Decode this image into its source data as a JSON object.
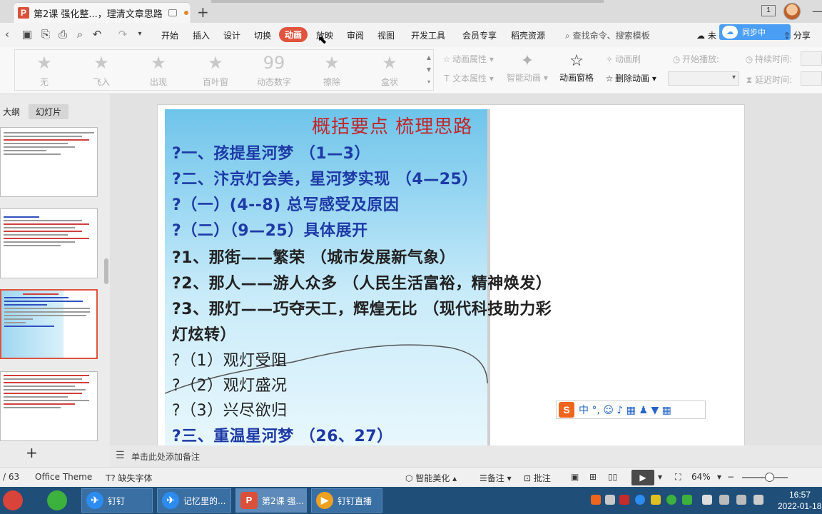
{
  "window": {
    "tab_title": "第2课 强化整...，理清文章思路",
    "logo_letter": "P",
    "new_tab": "+",
    "badge": "1"
  },
  "menu": {
    "items": [
      "开始",
      "插入",
      "设计",
      "切换",
      "动画",
      "放映",
      "审阅",
      "视图",
      "开发工具",
      "会员专享",
      "稻壳资源"
    ],
    "active": "动画",
    "search_placeholder": "查找命令、搜索模板",
    "cloud_status": "未",
    "cloud_badge_text": "同步中",
    "share": "分享"
  },
  "ribbon": {
    "effects": [
      "无",
      "飞入",
      "出现",
      "百叶窗",
      "动态数字",
      "擦除",
      "盒状"
    ],
    "animation_props": "动画属性",
    "text_props": "文本属性",
    "smart_animation": "智能动画",
    "animation_pane": "动画窗格",
    "animation_brush": "动画刷",
    "delete_animation": "删除动画",
    "start_play": "开始播放:",
    "duration": "持续时间:",
    "delay": "延迟时间:"
  },
  "left_panel": {
    "tab_outline": "大纲",
    "tab_slides": "幻灯片",
    "add_slide": "+"
  },
  "slide": {
    "title": "概括要点  梳理思路",
    "lines": [
      {
        "text": "?一、孩提星河梦       （1—3）",
        "style": "blue"
      },
      {
        "text": "?二、汴京灯会美，星河梦实现   （4—25）",
        "style": "blue"
      },
      {
        "text": "?（一）(4--8) 总写感受及原因",
        "style": "blue"
      },
      {
        "text": "?（二）（9—25）具体展开",
        "style": "blue"
      },
      {
        "text": "?1、那街——繁荣    （城市发展新气象）",
        "style": "dark"
      },
      {
        "text": "?2、那人——游人众多   （人民生活富裕，精神焕发）",
        "style": "dark"
      },
      {
        "text": "?3、那灯——巧夺天工，辉煌无比  （现代科技助力彩",
        "style": "dark"
      },
      {
        "text": "灯炫转）",
        "style": "dark"
      },
      {
        "text": "?（1）观灯受阻",
        "style": "plain"
      },
      {
        "text": "?（2）观灯盛况",
        "style": "plain"
      },
      {
        "text": "?（3）兴尽欲归",
        "style": "plain"
      },
      {
        "text": "?三、重温星河梦      （26、27）",
        "style": "blue"
      }
    ],
    "ime_logo": "S",
    "ime_text": "中 °, ☺ ♪ ▦ ♟ ▼ ▦"
  },
  "notes": {
    "placeholder": "单击此处添加备注"
  },
  "status": {
    "page": "/ 63",
    "theme": "Office Theme",
    "missing_font": "缺失字体",
    "smart_beautify": "智能美化",
    "notes": "备注",
    "comments": "批注",
    "zoom": "64%"
  },
  "taskbar": {
    "apps": [
      {
        "label": "钉钉",
        "icon": "✈"
      },
      {
        "label": "记忆里的...",
        "icon": "✈"
      },
      {
        "label": "第2课 强...",
        "icon": "P"
      },
      {
        "label": "钉钉直播",
        "icon": "▶"
      }
    ],
    "time": "16:57",
    "date": "2022-01-18"
  },
  "colors": {
    "accent": "#e0533d",
    "taskbar": "#1f4e79",
    "slide_title": "#c0262a",
    "slide_text_blue": "#1e3aa6"
  }
}
